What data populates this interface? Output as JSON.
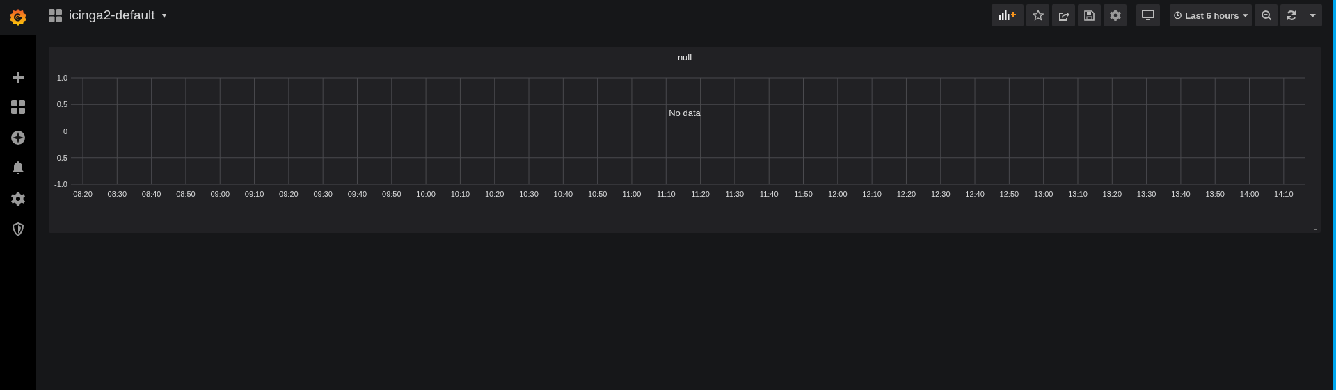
{
  "dashboard": {
    "title": "icinga2-default",
    "caret": "▾"
  },
  "toolbar": {
    "time_range": "Last 6 hours"
  },
  "panel": {
    "title": "null",
    "message": "No data",
    "chart_data": {
      "type": "line",
      "grid": true,
      "ylim": [
        -1,
        1
      ],
      "yticks": [
        {
          "value": 1,
          "label": "1.0"
        },
        {
          "value": 0.5,
          "label": "0.5"
        },
        {
          "value": 0,
          "label": "0"
        },
        {
          "value": -0.5,
          "label": "-0.5"
        },
        {
          "value": -1,
          "label": "-1.0"
        }
      ],
      "categories": [
        "08:20",
        "08:30",
        "08:40",
        "08:50",
        "09:00",
        "09:10",
        "09:20",
        "09:30",
        "09:40",
        "09:50",
        "10:00",
        "10:10",
        "10:20",
        "10:30",
        "10:40",
        "10:50",
        "11:00",
        "11:10",
        "11:20",
        "11:30",
        "11:40",
        "11:50",
        "12:00",
        "12:10",
        "12:20",
        "12:30",
        "12:40",
        "12:50",
        "13:00",
        "13:10",
        "13:20",
        "13:30",
        "13:40",
        "13:50",
        "14:00",
        "14:10"
      ]
    }
  }
}
